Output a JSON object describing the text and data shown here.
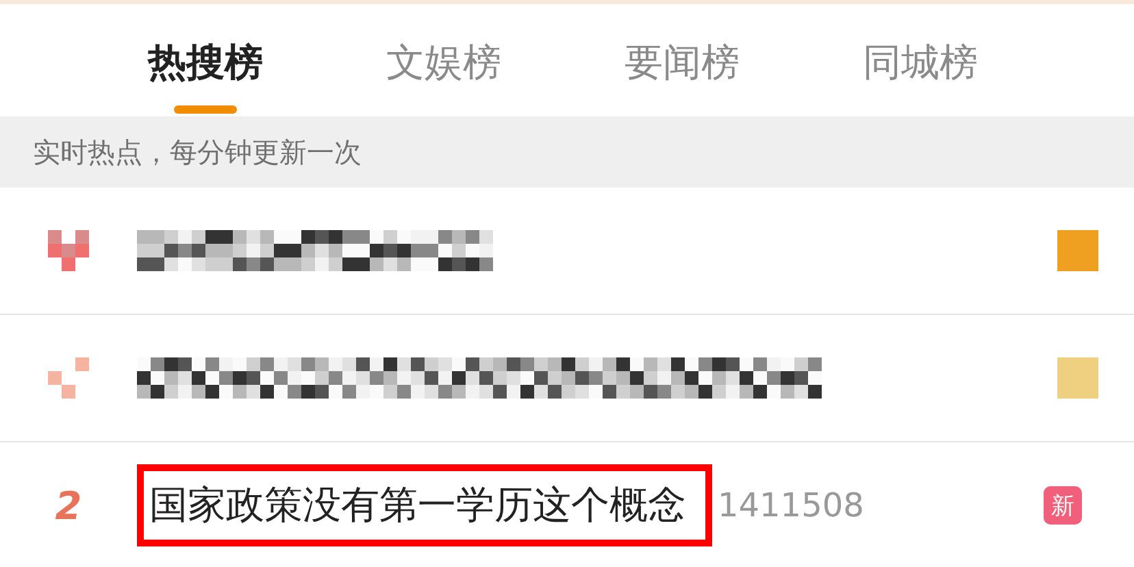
{
  "tabs": [
    {
      "label": "热搜榜",
      "selected": true
    },
    {
      "label": "文娱榜",
      "selected": false
    },
    {
      "label": "要闻榜",
      "selected": false
    },
    {
      "label": "同城榜",
      "selected": false
    }
  ],
  "notice": "实时热点，每分钟更新一次",
  "rows": [
    {
      "kind": "redacted",
      "color": "#f0a020"
    },
    {
      "kind": "redacted",
      "color": "#efd080"
    },
    {
      "kind": "entry",
      "rank": "2",
      "title": "国家政策没有第一学历这个概念",
      "count": "1411508",
      "badge": "新",
      "highlighted": true
    }
  ]
}
